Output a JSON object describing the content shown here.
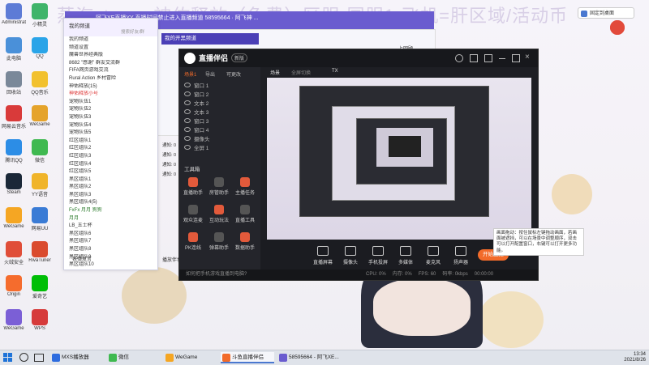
{
  "wallpaper": {
    "title": "蒸汽steam-神佑释放（免费）区服-国服1-飞机=肝区域/活动币",
    "date_deco": "2021/8/26"
  },
  "desktop_icons": [
    {
      "label": "Administrator",
      "color": "#5d7bd6"
    },
    {
      "label": "小精灵",
      "color": "#3fb46a"
    },
    {
      "label": "此电脑",
      "color": "#4a90d9"
    },
    {
      "label": "QQ",
      "color": "#2aa4e8"
    },
    {
      "label": "回收站",
      "color": "#7a8899"
    },
    {
      "label": "QQ音乐",
      "color": "#f2c12e"
    },
    {
      "label": "网易云音乐",
      "color": "#d93a3a"
    },
    {
      "label": "WeGame",
      "color": "#e5a32b"
    },
    {
      "label": "腾讯QQ",
      "color": "#2c8de6"
    },
    {
      "label": "微信",
      "color": "#3fb950"
    },
    {
      "label": "Steam",
      "color": "#1b2838"
    },
    {
      "label": "YY语音",
      "color": "#f0b429"
    },
    {
      "label": "WeGame",
      "color": "#f5a623"
    },
    {
      "label": "网易UU",
      "color": "#3a7bd5"
    },
    {
      "label": "火绒安全",
      "color": "#e04e39"
    },
    {
      "label": "RivaTuner",
      "color": "#da4b2e"
    },
    {
      "label": "Origin",
      "color": "#f56c2d"
    },
    {
      "label": "爱奇艺",
      "color": "#00be06"
    },
    {
      "label": "WeGame",
      "color": "#7b5fd6"
    },
    {
      "label": "WPS",
      "color": "#d63b3b"
    }
  ],
  "chat_window": {
    "title": "我的频道",
    "search_placeholder": "搜索好友/群",
    "list": [
      {
        "text": "我的频道",
        "style": "normal"
      },
      {
        "text": "频道设置",
        "style": "normal"
      },
      {
        "text": "魔兽世界经典版",
        "style": "normal"
      },
      {
        "text": "8682 \"感谢\" 群友交流群",
        "style": "normal"
      },
      {
        "text": "FIFA网页游戏交流",
        "style": "normal"
      },
      {
        "text": "Rural Action 乡村冒险",
        "style": "normal"
      },
      {
        "text": "神佑释放(15)",
        "style": "normal"
      },
      {
        "text": "神佑释放小号",
        "style": "red"
      },
      {
        "text": "宠物队伍1",
        "style": "normal"
      },
      {
        "text": "宠物队伍2",
        "style": "normal"
      },
      {
        "text": "宠物队伍3",
        "style": "normal"
      },
      {
        "text": "宠物队伍4",
        "style": "normal"
      },
      {
        "text": "宠物队伍5",
        "style": "normal"
      },
      {
        "text": "红区组队1",
        "style": "normal"
      },
      {
        "text": "红区组队2",
        "style": "normal"
      },
      {
        "text": "红区组队3",
        "style": "normal"
      },
      {
        "text": "红区组队4",
        "style": "normal"
      },
      {
        "text": "红区组队5",
        "style": "normal"
      },
      {
        "text": "黑区组队1",
        "style": "normal"
      },
      {
        "text": "黑区组队2",
        "style": "normal"
      },
      {
        "text": "黑区组队3",
        "style": "normal"
      },
      {
        "text": "黑区组队4(5)",
        "style": "normal"
      },
      {
        "text": "FxFx 月月 狗狗",
        "style": "green"
      },
      {
        "text": "月月",
        "style": "green"
      },
      {
        "text": "LB_五士杯",
        "style": "normal"
      },
      {
        "text": "黑区组队6",
        "style": "normal"
      },
      {
        "text": "黑区组队7",
        "style": "normal"
      },
      {
        "text": "黑区组队8",
        "style": "normal"
      },
      {
        "text": "黑区组队9",
        "style": "normal"
      },
      {
        "text": "黑区组队10",
        "style": "normal"
      }
    ],
    "footer": "表情发言"
  },
  "yy_window": {
    "title": "阿飞XE直播YY 直播时间禁止进入直播频道 58595664 · 阿飞神 ...",
    "tab_mine": "我的开黑频道",
    "tab_right": "上回顾",
    "rows": [
      "通知: 0",
      "通知: 0",
      "通知: 0",
      "通知: 0"
    ],
    "footer_link": "播放伴奏"
  },
  "live_app": {
    "logo": "直播伴侣",
    "badge": "新版",
    "tabs": [
      "场景1",
      "导出",
      "可更改"
    ],
    "preview_tabs": [
      "场景",
      "TX"
    ],
    "preview_label": "全屏切换",
    "scenes": [
      {
        "name": "窗口 1"
      },
      {
        "name": "窗口 2"
      },
      {
        "name": "文本 2"
      },
      {
        "name": "文本 3"
      },
      {
        "name": "窗口 3"
      },
      {
        "name": "窗口 4"
      },
      {
        "name": "摄像头"
      },
      {
        "name": "全屏 1"
      }
    ],
    "tools_title": "工具箱",
    "tools": [
      {
        "label": "直播助手"
      },
      {
        "label": "房管助手"
      },
      {
        "label": "主播任务"
      },
      {
        "label": "观众连麦"
      },
      {
        "label": "互动玩法"
      },
      {
        "label": "直播工具"
      },
      {
        "label": "PK连线"
      },
      {
        "label": "弹幕助手"
      },
      {
        "label": "数据助手"
      }
    ],
    "bottom_buttons": [
      {
        "label": "直播屏幕"
      },
      {
        "label": "摄像头"
      },
      {
        "label": "手机投屏"
      },
      {
        "label": "多媒体"
      },
      {
        "label": "麦克风"
      },
      {
        "label": "扬声器"
      }
    ],
    "go_live": "开始直播",
    "status_hint": "如何把手机游戏直播到电脑?",
    "stats": [
      "CPU: 0%",
      "内存: 0%",
      "FPS: 60",
      "码率: 0kbps",
      "00:00:00"
    ]
  },
  "tooltip": "画面拖动：按住鼠标左键拖动画面，若画面被遮挡，可以在场景中调整顺序，双击可以打开配置窗口，右键可以打开更多功能。",
  "pin_button": "固定到桌面",
  "taskbar": {
    "items": [
      {
        "label": "MXS播放器",
        "color": "#2d6cdf",
        "active": false
      },
      {
        "label": "微信",
        "color": "#3fb950",
        "active": false
      },
      {
        "label": "WeGame",
        "color": "#f5a623",
        "active": false
      },
      {
        "label": "斗鱼直播伴侣",
        "color": "#f26b2a",
        "active": true
      },
      {
        "label": "58595664 - 阿飞XE...",
        "color": "#6a5ccf",
        "active": false
      }
    ],
    "time": "13:34",
    "date": "2021/8/26"
  }
}
